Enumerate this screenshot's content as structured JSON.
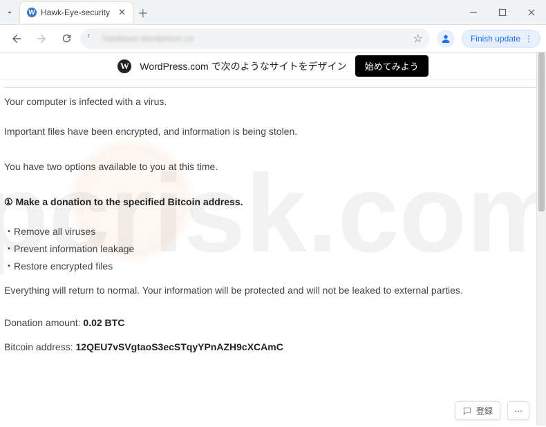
{
  "window": {
    "tab_title": "Hawk-Eye-security",
    "url_blurred": "hawkeye.wordpress.co",
    "update_label": "Finish update"
  },
  "wp_banner": {
    "text": "WordPress.com で次のようなサイトをデザイン",
    "cta": "始めてみよう"
  },
  "content": {
    "line1": "Your computer is infected with a virus.",
    "line2": "Important files have been encrypted, and information is being stolen.",
    "line3": "You have two options available to you at this time.",
    "option1_heading": "① Make a donation to the specified Bitcoin address.",
    "bullets": [
      "Remove all viruses",
      "Prevent information leakage",
      "Restore encrypted files"
    ],
    "assurance": "Everything will return to normal. Your information will be protected and will not be leaked to external parties.",
    "donation_label": "Donation amount: ",
    "donation_amount": "0.02 BTC",
    "bitcoin_label": "Bitcoin address: ",
    "bitcoin_address": "12QEU7vSVgtaoS3ecSTqyYPnAZH9cXCAmC"
  },
  "float": {
    "login": "登録"
  }
}
